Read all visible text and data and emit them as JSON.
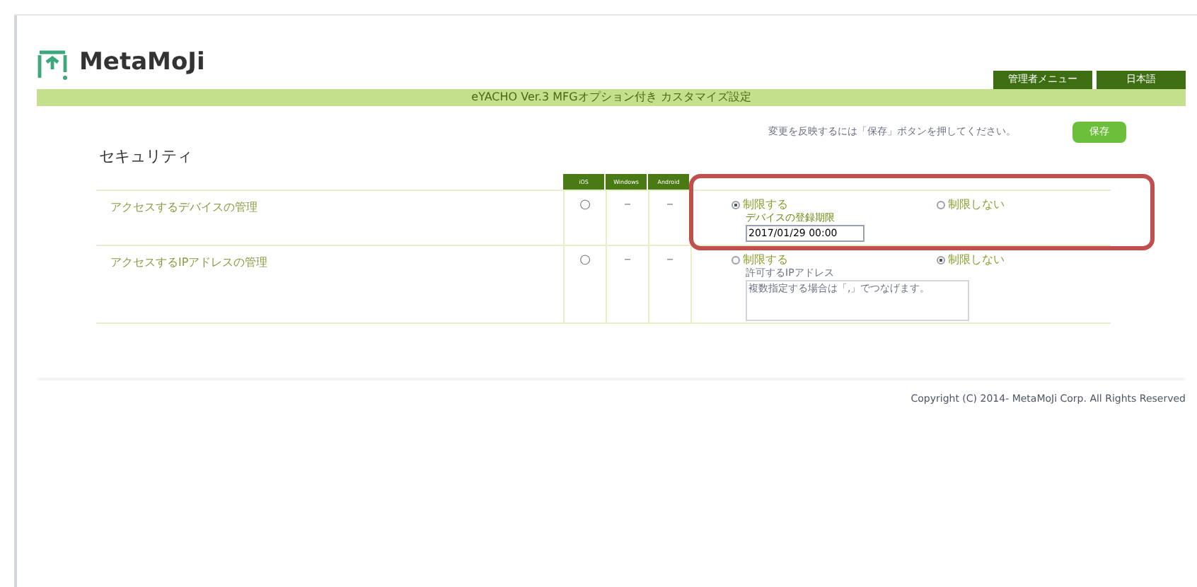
{
  "header": {
    "logo_text": "MetaMoJi",
    "buttons": [
      {
        "label": "管理者メニュー"
      },
      {
        "label": "日本語"
      }
    ]
  },
  "title_bar": {
    "title": "eYACHO Ver.3 MFGオプション付き カスタマイズ設定"
  },
  "save_hint": "変更を反映するには「保存」ボタンを押してください。",
  "save_button": "保存",
  "section_title": "セキュリティ",
  "table": {
    "columns": [
      "iOS",
      "Windows",
      "Android"
    ],
    "rows": [
      {
        "label": "アクセスするデバイスの管理",
        "cells": [
          "○",
          "－",
          "－"
        ],
        "options": [
          {
            "label": "制限する",
            "selected": true
          },
          {
            "label": "制限しない",
            "selected": false
          }
        ],
        "sub_label": "デバイスの登録期限",
        "field": {
          "kind": "input",
          "value": "2017/01/29 00:00",
          "disabled": false
        }
      },
      {
        "label": "アクセスするIPアドレスの管理",
        "cells": [
          "○",
          "－",
          "－"
        ],
        "options": [
          {
            "label": "制限する",
            "selected": false
          },
          {
            "label": "制限しない",
            "selected": true
          }
        ],
        "sub_label": "許可するIPアドレス",
        "field": {
          "kind": "textarea",
          "placeholder": "複数指定する場合は「,」でつなげます。",
          "disabled": true
        }
      }
    ]
  },
  "footer": {
    "copyright": "Copyright (C) 2014- MetaMoJi Corp. All Rights Reserved"
  }
}
